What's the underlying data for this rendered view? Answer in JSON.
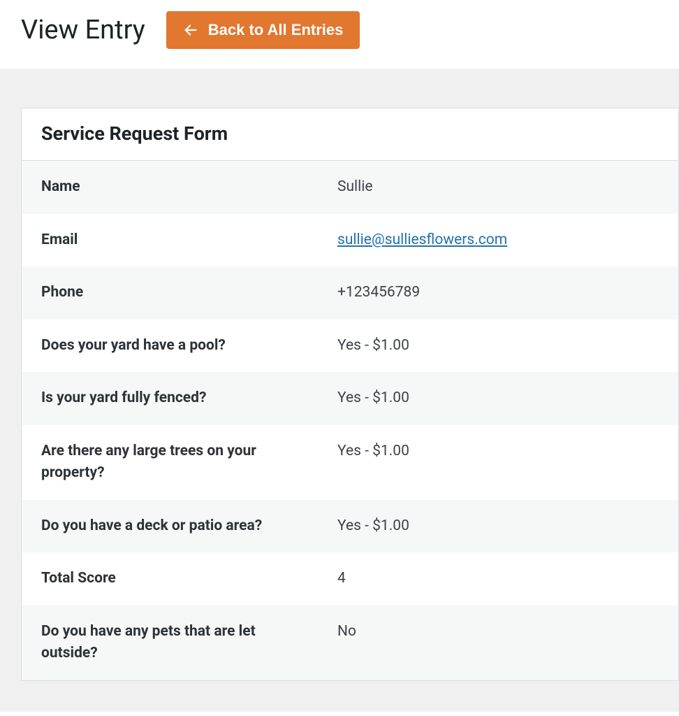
{
  "header": {
    "title": "View Entry",
    "back_button_label": "Back to All Entries"
  },
  "card": {
    "title": "Service Request Form"
  },
  "fields": {
    "name": {
      "label": "Name",
      "value": "Sullie"
    },
    "email": {
      "label": "Email",
      "value": "sullie@sulliesflowers.com"
    },
    "phone": {
      "label": "Phone",
      "value": "+123456789"
    },
    "pool": {
      "label": "Does your yard have a pool?",
      "value": "Yes - $1.00"
    },
    "fenced": {
      "label": "Is your yard fully fenced?",
      "value": "Yes - $1.00"
    },
    "trees": {
      "label": "Are there any large trees on your property?",
      "value": "Yes - $1.00"
    },
    "deck": {
      "label": "Do you have a deck or patio area?",
      "value": "Yes - $1.00"
    },
    "total_score": {
      "label": "Total Score",
      "value": "4"
    },
    "pets": {
      "label": "Do you have any pets that are let outside?",
      "value": "No"
    }
  }
}
